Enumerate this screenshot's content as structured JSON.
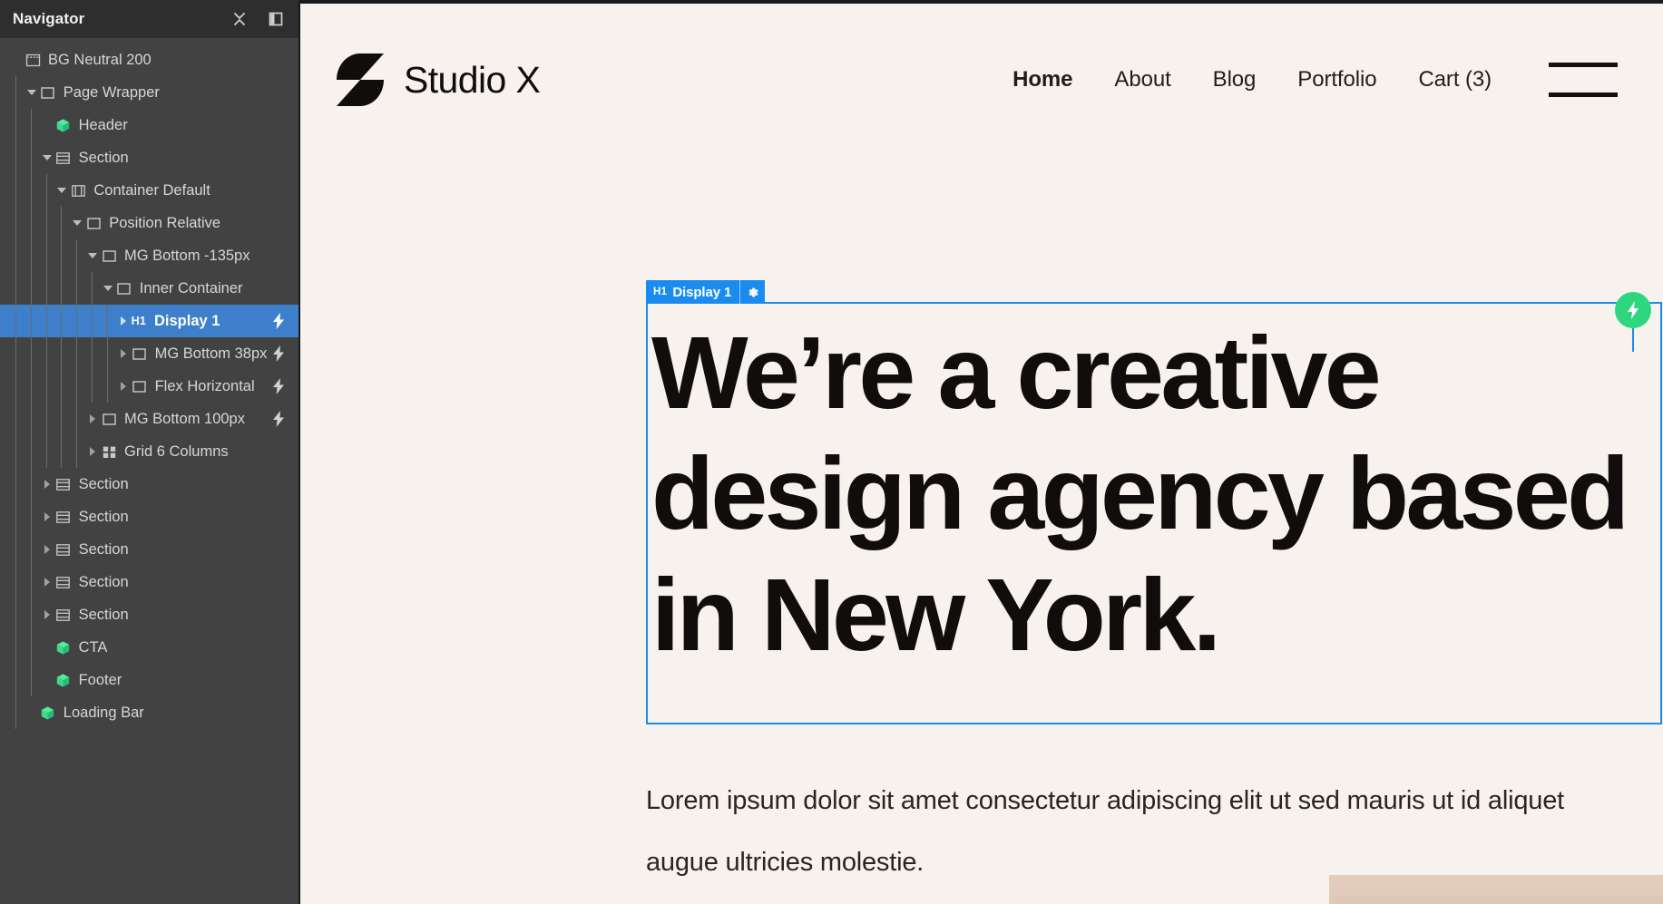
{
  "panel": {
    "title": "Navigator",
    "icons": [
      {
        "name": "collapse-all-icon",
        "glyph": "collapse"
      },
      {
        "name": "panel-layout-icon",
        "glyph": "panel"
      }
    ],
    "tree": [
      {
        "label": "BG Neutral 200",
        "depth": 0,
        "icon": "body",
        "twisty": "none",
        "bolt": false,
        "selected": false,
        "tag": ""
      },
      {
        "label": "Page Wrapper",
        "depth": 1,
        "icon": "div",
        "twisty": "down",
        "bolt": false,
        "selected": false,
        "tag": ""
      },
      {
        "label": "Header",
        "depth": 2,
        "icon": "component",
        "twisty": "none",
        "bolt": false,
        "selected": false,
        "tag": ""
      },
      {
        "label": "Section",
        "depth": 2,
        "icon": "section",
        "twisty": "down",
        "bolt": false,
        "selected": false,
        "tag": ""
      },
      {
        "label": "Container Default",
        "depth": 3,
        "icon": "container",
        "twisty": "down",
        "bolt": false,
        "selected": false,
        "tag": ""
      },
      {
        "label": "Position Relative",
        "depth": 4,
        "icon": "div",
        "twisty": "down",
        "bolt": false,
        "selected": false,
        "tag": ""
      },
      {
        "label": "MG Bottom -135px",
        "depth": 5,
        "icon": "div",
        "twisty": "down",
        "bolt": false,
        "selected": false,
        "tag": ""
      },
      {
        "label": "Inner Container",
        "depth": 6,
        "icon": "div",
        "twisty": "down",
        "bolt": false,
        "selected": false,
        "tag": ""
      },
      {
        "label": "Display 1",
        "depth": 7,
        "icon": "heading",
        "twisty": "right",
        "bolt": true,
        "selected": true,
        "tag": "H1"
      },
      {
        "label": "MG Bottom 38px",
        "depth": 7,
        "icon": "div",
        "twisty": "right",
        "bolt": true,
        "selected": false,
        "tag": ""
      },
      {
        "label": "Flex Horizontal",
        "depth": 7,
        "icon": "div",
        "twisty": "right",
        "bolt": true,
        "selected": false,
        "tag": ""
      },
      {
        "label": "MG Bottom 100px",
        "depth": 5,
        "icon": "div",
        "twisty": "right",
        "bolt": true,
        "selected": false,
        "tag": ""
      },
      {
        "label": "Grid 6 Columns",
        "depth": 5,
        "icon": "grid",
        "twisty": "right",
        "bolt": false,
        "selected": false,
        "tag": ""
      },
      {
        "label": "Section",
        "depth": 2,
        "icon": "section",
        "twisty": "right",
        "bolt": false,
        "selected": false,
        "tag": ""
      },
      {
        "label": "Section",
        "depth": 2,
        "icon": "section",
        "twisty": "right",
        "bolt": false,
        "selected": false,
        "tag": ""
      },
      {
        "label": "Section",
        "depth": 2,
        "icon": "section",
        "twisty": "right",
        "bolt": false,
        "selected": false,
        "tag": ""
      },
      {
        "label": "Section",
        "depth": 2,
        "icon": "section",
        "twisty": "right",
        "bolt": false,
        "selected": false,
        "tag": ""
      },
      {
        "label": "Section",
        "depth": 2,
        "icon": "section",
        "twisty": "right",
        "bolt": false,
        "selected": false,
        "tag": ""
      },
      {
        "label": "CTA",
        "depth": 2,
        "icon": "component",
        "twisty": "none",
        "bolt": false,
        "selected": false,
        "tag": ""
      },
      {
        "label": "Footer",
        "depth": 2,
        "icon": "component",
        "twisty": "none",
        "bolt": false,
        "selected": false,
        "tag": ""
      },
      {
        "label": "Loading Bar",
        "depth": 1,
        "icon": "component",
        "twisty": "none",
        "bolt": false,
        "selected": false,
        "tag": ""
      }
    ]
  },
  "selection": {
    "tag": "H1",
    "name": "Display 1",
    "border_color": "#1a8cf0",
    "badge_color": "#1a8cf0",
    "marker_color": "#2ed77f"
  },
  "site": {
    "brand": "Studio X",
    "nav": [
      {
        "label": "Home",
        "active": true
      },
      {
        "label": "About",
        "active": false
      },
      {
        "label": "Blog",
        "active": false
      },
      {
        "label": "Portfolio",
        "active": false
      },
      {
        "label": "Cart (3)",
        "active": false
      }
    ],
    "hero_heading": "We’re a creative design agency based in New York.",
    "hero_paragraph": "Lorem ipsum dolor sit amet consectetur adipiscing elit ut sed mauris ut id aliquet augue ultricies molestie."
  },
  "theme": {
    "panel_bg": "#424242",
    "panel_header_bg": "#2e2e2e",
    "selected_row": "#3e7fcb",
    "canvas_bg": "#f7f2ee",
    "component_green": "#2ed77f",
    "image_tan": "#e0c9b8"
  }
}
